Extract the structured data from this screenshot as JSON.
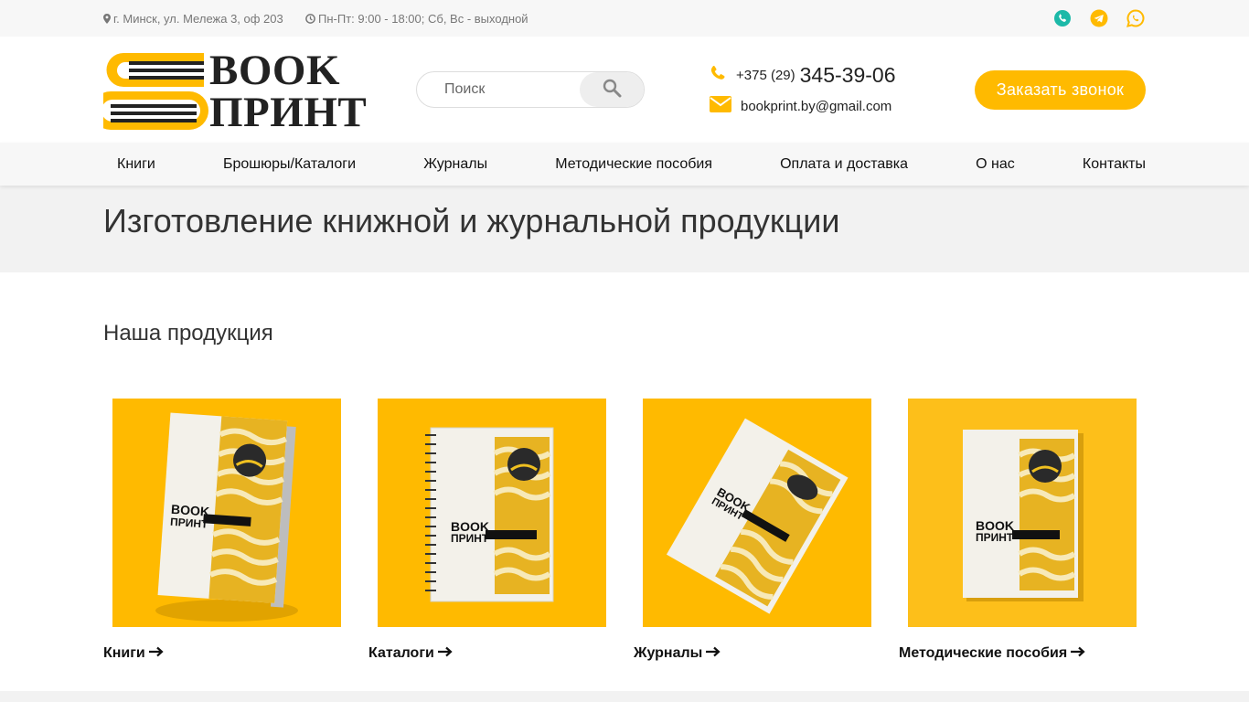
{
  "topbar": {
    "address": "г. Минск, ул. Мележа 3, оф 203",
    "hours": "Пн-Пт: 9:00 - 18:00; Сб, Вс - выходной",
    "socials": [
      {
        "icon": "viber-icon",
        "color": "#1cb9a8"
      },
      {
        "icon": "telegram-icon",
        "color": "#ffba00"
      },
      {
        "icon": "whatsapp-icon",
        "color": "#ffba00"
      }
    ]
  },
  "header": {
    "logo": {
      "line1": "BOOK",
      "line2": "ПРИНТ"
    },
    "search": {
      "placeholder": "Поиск"
    },
    "phone_prefix": "+375 (29)",
    "phone_number": "345-39-06",
    "email": "bookprint.by@gmail.com",
    "call_button": "Заказать звонок"
  },
  "nav": {
    "items": [
      {
        "label": "Книги"
      },
      {
        "label": "Брошюры/Каталоги"
      },
      {
        "label": "Журналы"
      },
      {
        "label": "Методические пособия"
      },
      {
        "label": "Оплата и доставка"
      },
      {
        "label": "О нас"
      },
      {
        "label": "Контакты"
      }
    ]
  },
  "banner": {
    "title": "Изготовление книжной и журнальной продукции"
  },
  "products": {
    "title": "Наша продукция",
    "items": [
      {
        "label": "Книги",
        "mockup_text_1": "BOOK",
        "mockup_text_2": "ПРИНТ"
      },
      {
        "label": "Каталоги",
        "mockup_text_1": "BOOK",
        "mockup_text_2": "ПРИНТ"
      },
      {
        "label": "Журналы",
        "mockup_text_1": "BOOK",
        "mockup_text_2": "ПРИНТ"
      },
      {
        "label": "Методические пособия",
        "mockup_text_1": "BOOK",
        "mockup_text_2": "ПРИНТ"
      }
    ]
  },
  "colors": {
    "accent": "#ffba00",
    "text": "#222222",
    "muted": "#777777",
    "band": "#f2f2f2"
  }
}
